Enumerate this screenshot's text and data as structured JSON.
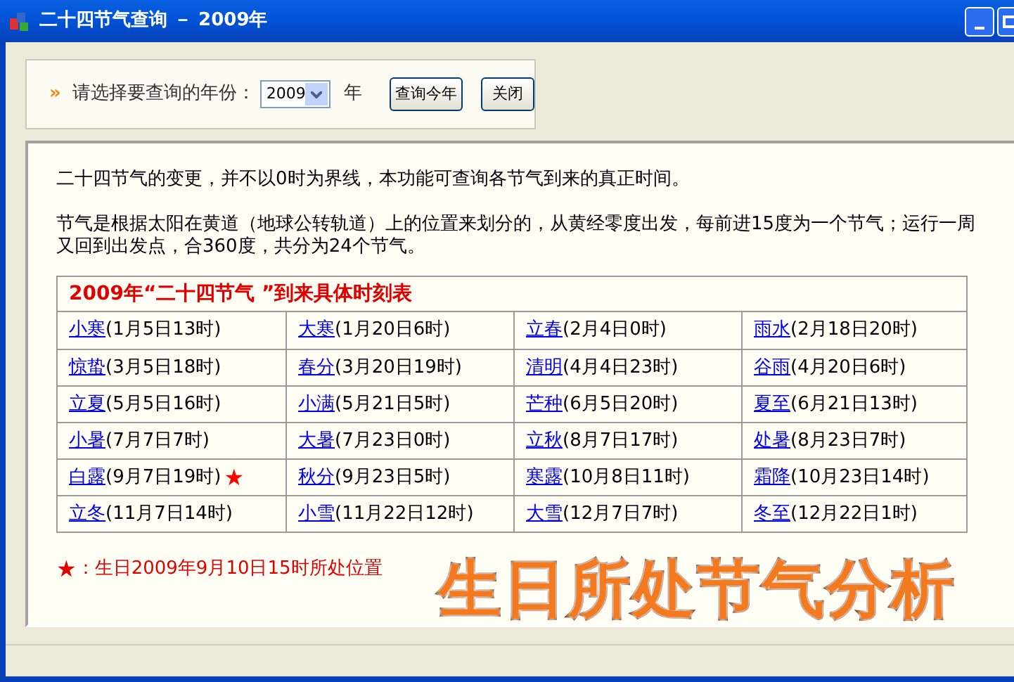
{
  "window": {
    "title": "二十四节气查询 － 2009年"
  },
  "query": {
    "marker": "»",
    "label": "请选择要查询的年份：",
    "year_value": "2009",
    "year_suffix": "年",
    "buttons": [
      "查询今年",
      "关闭"
    ]
  },
  "intro": [
    "二十四节气的变更，并不以0时为界线，本功能可查询各节气到来的真正时间。",
    "节气是根据太阳在黄道（地球公转轨道）上的位置来划分的，从黄经零度出发，每前进15度为一个节气；运行一周又回到出发点，合360度，共分为24个节气。"
  ],
  "table": {
    "title": "2009年“二十四节气 ”到来具体时刻表",
    "rows": [
      [
        {
          "name": "小寒",
          "time": "(1月5日13时)"
        },
        {
          "name": "大寒",
          "time": "(1月20日6时)"
        },
        {
          "name": "立春",
          "time": "(2月4日0时)"
        },
        {
          "name": "雨水",
          "time": "(2月18日20时)"
        }
      ],
      [
        {
          "name": "惊蛰",
          "time": "(3月5日18时)"
        },
        {
          "name": "春分",
          "time": "(3月20日19时)"
        },
        {
          "name": "清明",
          "time": "(4月4日23时)"
        },
        {
          "name": "谷雨",
          "time": "(4月20日6时)"
        }
      ],
      [
        {
          "name": "立夏",
          "time": "(5月5日16时)"
        },
        {
          "name": "小满",
          "time": "(5月21日5时)"
        },
        {
          "name": "芒种",
          "time": "(6月5日20时)"
        },
        {
          "name": "夏至",
          "time": "(6月21日13时)"
        }
      ],
      [
        {
          "name": "小暑",
          "time": "(7月7日7时)"
        },
        {
          "name": "大暑",
          "time": "(7月23日0时)"
        },
        {
          "name": "立秋",
          "time": "(8月7日17时)"
        },
        {
          "name": "处暑",
          "time": "(8月23日7时)"
        }
      ],
      [
        {
          "name": "白露",
          "time": "(9月7日19时)",
          "marker": "★"
        },
        {
          "name": "秋分",
          "time": "(9月23日5时)"
        },
        {
          "name": "寒露",
          "time": "(10月8日11时)"
        },
        {
          "name": "霜降",
          "time": "(10月23日14时)"
        }
      ],
      [
        {
          "name": "立冬",
          "time": "(11月7日14时)"
        },
        {
          "name": "小雪",
          "time": "(11月22日12时)"
        },
        {
          "name": "大雪",
          "time": "(12月7日7时)"
        },
        {
          "name": "冬至",
          "time": "(12月22日1时)"
        }
      ]
    ]
  },
  "legend": {
    "marker": "★",
    "text": "：生日2009年9月10日15时所处位置"
  },
  "caption": "生日所处节气分析"
}
